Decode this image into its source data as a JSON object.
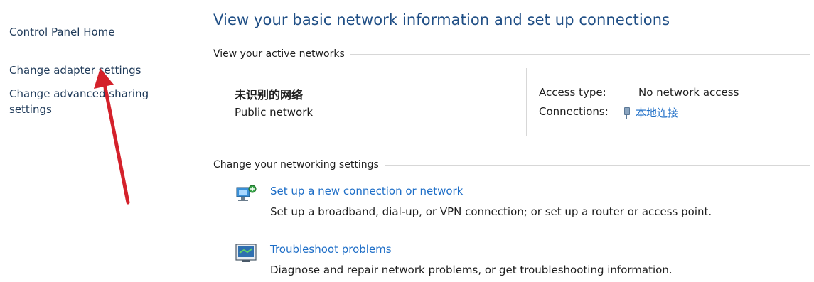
{
  "sidebar": {
    "control_panel_home": "Control Panel Home",
    "change_adapter_settings": "Change adapter settings",
    "change_advanced_sharing_line1": "Change advanced sharing",
    "change_advanced_sharing_line2": "settings"
  },
  "main": {
    "title": "View your basic network information and set up connections",
    "active_networks": {
      "heading": "View your active networks",
      "network_name": "未识别的网络",
      "network_type": "Public network",
      "access_type_label": "Access type:",
      "access_type_value": "No network access",
      "connections_label": "Connections:",
      "connections_value": "本地连接",
      "connections_icon": "network-adapter-icon"
    },
    "networking_settings": {
      "heading": "Change your networking settings",
      "tasks": [
        {
          "icon": "new-connection-icon",
          "link": "Set up a new connection or network",
          "description": "Set up a broadband, dial-up, or VPN connection; or set up a router or access point."
        },
        {
          "icon": "troubleshoot-icon",
          "link": "Troubleshoot problems",
          "description": "Diagnose and repair network problems, or get troubleshooting information."
        }
      ]
    }
  },
  "annotation": {
    "arrow_color": "#d4212b"
  },
  "colors": {
    "link": "#1e6ec7",
    "title": "#1f4e85",
    "sidebar_link": "#1f3a59"
  }
}
